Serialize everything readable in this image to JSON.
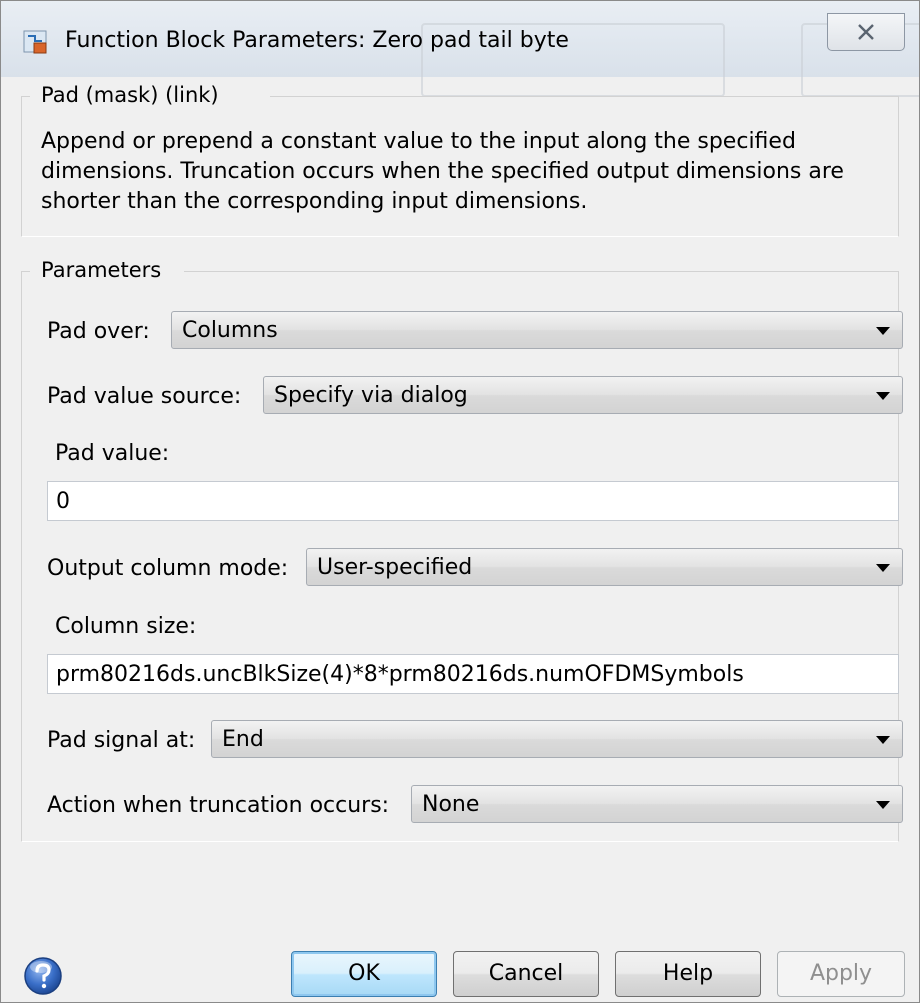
{
  "window": {
    "title": "Function Block Parameters: Zero pad tail byte"
  },
  "mask_group": {
    "label": "Pad (mask) (link)",
    "description": "Append or prepend a constant value to the input along the specified dimensions.  Truncation occurs when the specified output dimensions are shorter than the corresponding input dimensions."
  },
  "params_group": {
    "label": "Parameters"
  },
  "params": {
    "pad_over": {
      "label": "Pad over:",
      "value": "Columns"
    },
    "pad_value_source": {
      "label": "Pad value source:",
      "value": "Specify via dialog"
    },
    "pad_value": {
      "label": "Pad value:",
      "value": "0"
    },
    "output_column_mode": {
      "label": "Output column mode:",
      "value": "User-specified"
    },
    "column_size": {
      "label": "Column size:",
      "value": "prm80216ds.uncBlkSize(4)*8*prm80216ds.numOFDMSymbols"
    },
    "pad_signal_at": {
      "label": "Pad signal at:",
      "value": "End"
    },
    "truncation_action": {
      "label": "Action when truncation occurs:",
      "value": "None"
    }
  },
  "buttons": {
    "ok": "OK",
    "cancel": "Cancel",
    "help": "Help",
    "apply": "Apply"
  },
  "icons": {
    "app": "simulink-block-icon",
    "close": "close-icon",
    "help": "help-question-icon"
  }
}
